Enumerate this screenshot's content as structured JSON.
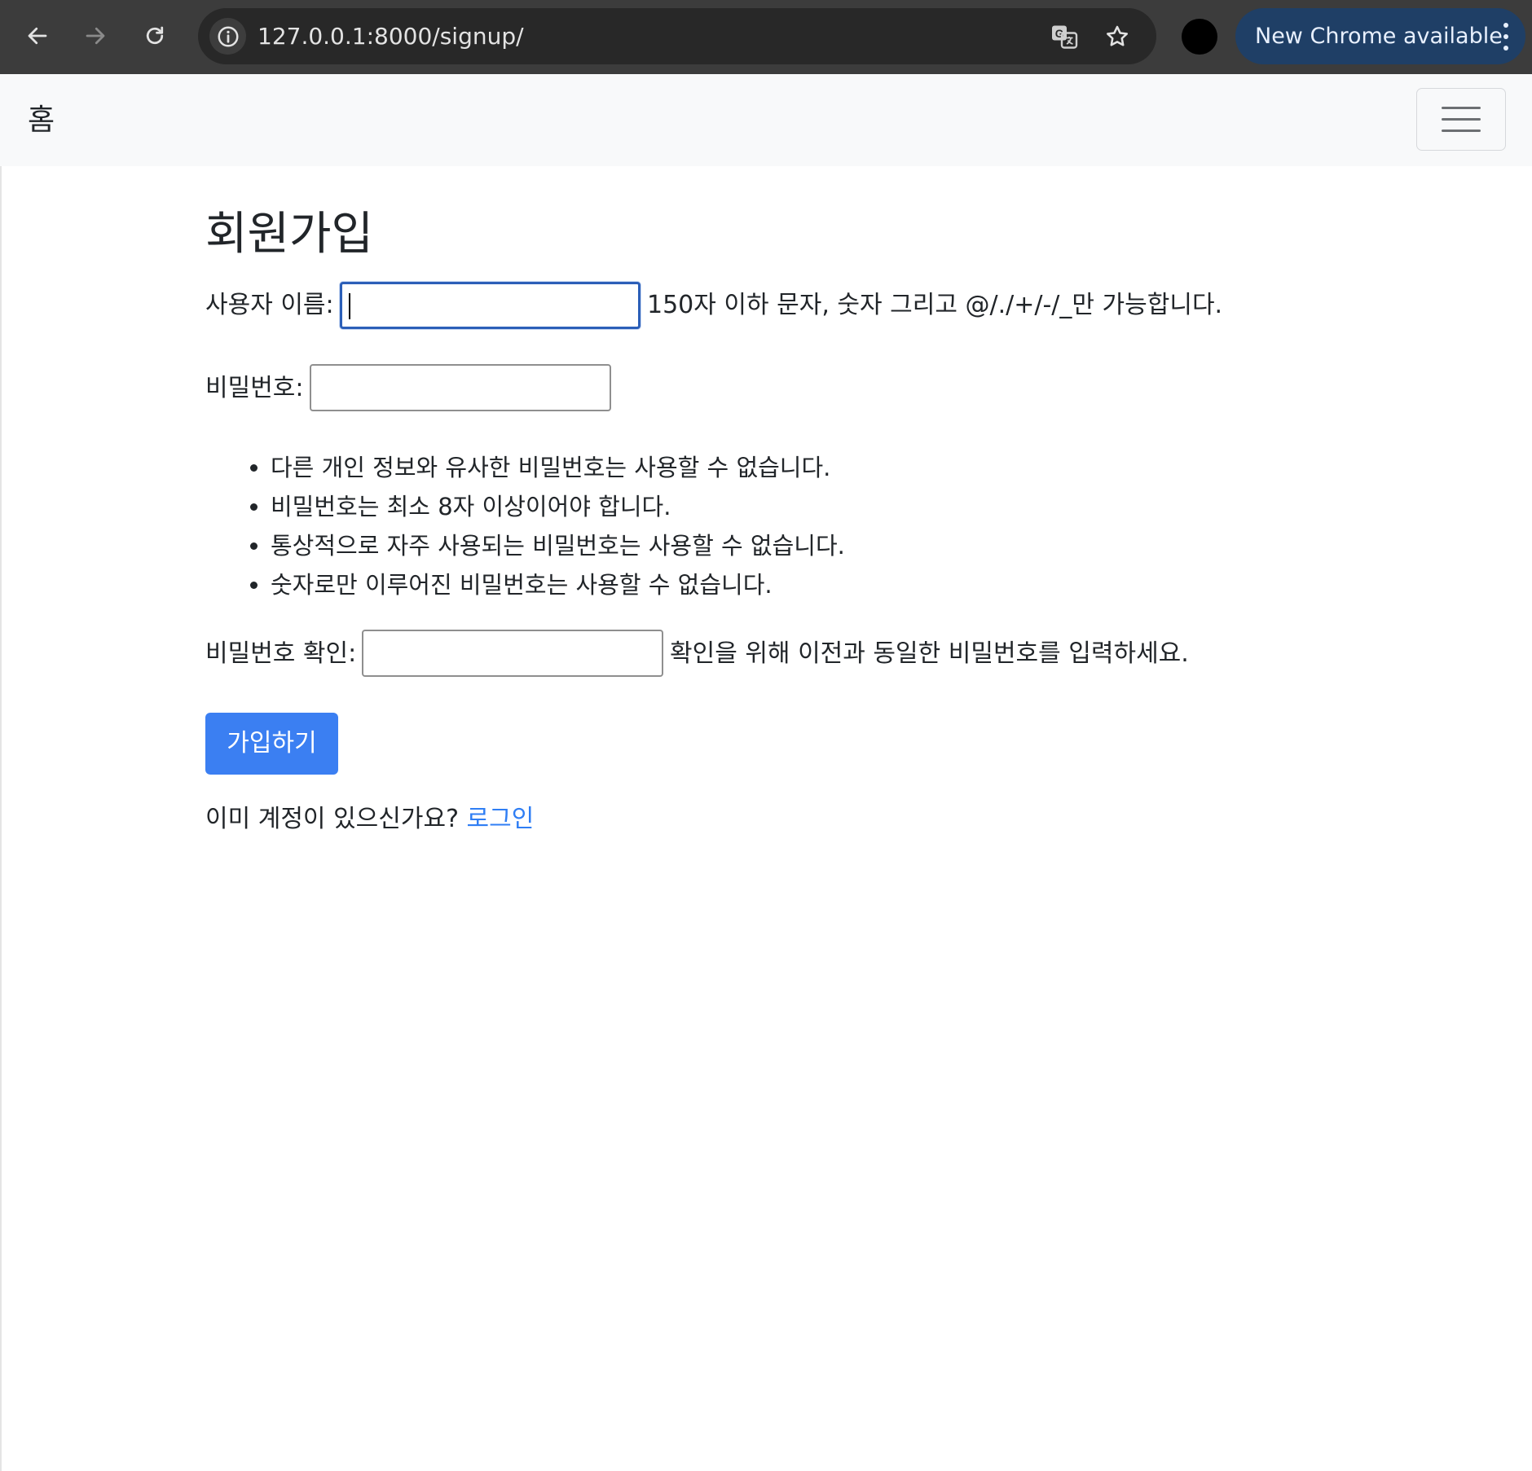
{
  "browser": {
    "url": "127.0.0.1:8000/signup/",
    "update_label": "New Chrome available"
  },
  "navbar": {
    "brand": "홈"
  },
  "form": {
    "title": "회원가입",
    "username_label": "사용자 이름:",
    "username_value": "",
    "username_help": "150자 이하 문자, 숫자 그리고 @/./+/-/_만 가능합니다.",
    "password_label": "비밀번호:",
    "password_value": "",
    "password_help": [
      "다른 개인 정보와 유사한 비밀번호는 사용할 수 없습니다.",
      "비밀번호는 최소 8자 이상이어야 합니다.",
      "통상적으로 자주 사용되는 비밀번호는 사용할 수 없습니다.",
      "숫자로만 이루어진 비밀번호는 사용할 수 없습니다."
    ],
    "password2_label": "비밀번호 확인:",
    "password2_value": "",
    "password2_help": "확인을 위해 이전과 동일한 비밀번호를 입력하세요.",
    "submit_label": "가입하기",
    "login_prompt": "이미 계정이 있으신가요?",
    "login_link": "로그인"
  },
  "colors": {
    "primary_button": "#3b7ff2",
    "link": "#2f7ef4",
    "navbar_bg": "#f8f9fa",
    "chrome_bar": "#3c3c3c",
    "update_pill": "#1f3f66"
  }
}
